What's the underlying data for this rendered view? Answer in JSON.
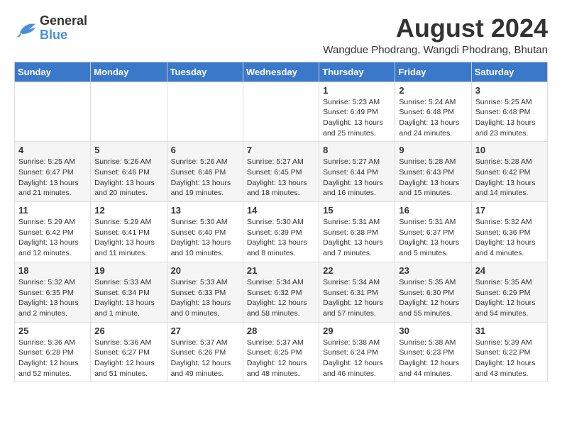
{
  "logo": {
    "text_general": "General",
    "text_blue": "Blue"
  },
  "header": {
    "month_year": "August 2024",
    "location": "Wangdue Phodrang, Wangdi Phodrang, Bhutan"
  },
  "weekdays": [
    "Sunday",
    "Monday",
    "Tuesday",
    "Wednesday",
    "Thursday",
    "Friday",
    "Saturday"
  ],
  "weeks": [
    [
      {
        "day": "",
        "sunrise": "",
        "sunset": "",
        "daylight": ""
      },
      {
        "day": "",
        "sunrise": "",
        "sunset": "",
        "daylight": ""
      },
      {
        "day": "",
        "sunrise": "",
        "sunset": "",
        "daylight": ""
      },
      {
        "day": "",
        "sunrise": "",
        "sunset": "",
        "daylight": ""
      },
      {
        "day": "1",
        "sunrise": "Sunrise: 5:23 AM",
        "sunset": "Sunset: 6:49 PM",
        "daylight": "Daylight: 13 hours and 25 minutes."
      },
      {
        "day": "2",
        "sunrise": "Sunrise: 5:24 AM",
        "sunset": "Sunset: 6:48 PM",
        "daylight": "Daylight: 13 hours and 24 minutes."
      },
      {
        "day": "3",
        "sunrise": "Sunrise: 5:25 AM",
        "sunset": "Sunset: 6:48 PM",
        "daylight": "Daylight: 13 hours and 23 minutes."
      }
    ],
    [
      {
        "day": "4",
        "sunrise": "Sunrise: 5:25 AM",
        "sunset": "Sunset: 6:47 PM",
        "daylight": "Daylight: 13 hours and 21 minutes."
      },
      {
        "day": "5",
        "sunrise": "Sunrise: 5:26 AM",
        "sunset": "Sunset: 6:46 PM",
        "daylight": "Daylight: 13 hours and 20 minutes."
      },
      {
        "day": "6",
        "sunrise": "Sunrise: 5:26 AM",
        "sunset": "Sunset: 6:46 PM",
        "daylight": "Daylight: 13 hours and 19 minutes."
      },
      {
        "day": "7",
        "sunrise": "Sunrise: 5:27 AM",
        "sunset": "Sunset: 6:45 PM",
        "daylight": "Daylight: 13 hours and 18 minutes."
      },
      {
        "day": "8",
        "sunrise": "Sunrise: 5:27 AM",
        "sunset": "Sunset: 6:44 PM",
        "daylight": "Daylight: 13 hours and 16 minutes."
      },
      {
        "day": "9",
        "sunrise": "Sunrise: 5:28 AM",
        "sunset": "Sunset: 6:43 PM",
        "daylight": "Daylight: 13 hours and 15 minutes."
      },
      {
        "day": "10",
        "sunrise": "Sunrise: 5:28 AM",
        "sunset": "Sunset: 6:42 PM",
        "daylight": "Daylight: 13 hours and 14 minutes."
      }
    ],
    [
      {
        "day": "11",
        "sunrise": "Sunrise: 5:29 AM",
        "sunset": "Sunset: 6:42 PM",
        "daylight": "Daylight: 13 hours and 12 minutes."
      },
      {
        "day": "12",
        "sunrise": "Sunrise: 5:29 AM",
        "sunset": "Sunset: 6:41 PM",
        "daylight": "Daylight: 13 hours and 11 minutes."
      },
      {
        "day": "13",
        "sunrise": "Sunrise: 5:30 AM",
        "sunset": "Sunset: 6:40 PM",
        "daylight": "Daylight: 13 hours and 10 minutes."
      },
      {
        "day": "14",
        "sunrise": "Sunrise: 5:30 AM",
        "sunset": "Sunset: 6:39 PM",
        "daylight": "Daylight: 13 hours and 8 minutes."
      },
      {
        "day": "15",
        "sunrise": "Sunrise: 5:31 AM",
        "sunset": "Sunset: 6:38 PM",
        "daylight": "Daylight: 13 hours and 7 minutes."
      },
      {
        "day": "16",
        "sunrise": "Sunrise: 5:31 AM",
        "sunset": "Sunset: 6:37 PM",
        "daylight": "Daylight: 13 hours and 5 minutes."
      },
      {
        "day": "17",
        "sunrise": "Sunrise: 5:32 AM",
        "sunset": "Sunset: 6:36 PM",
        "daylight": "Daylight: 13 hours and 4 minutes."
      }
    ],
    [
      {
        "day": "18",
        "sunrise": "Sunrise: 5:32 AM",
        "sunset": "Sunset: 6:35 PM",
        "daylight": "Daylight: 13 hours and 2 minutes."
      },
      {
        "day": "19",
        "sunrise": "Sunrise: 5:33 AM",
        "sunset": "Sunset: 6:34 PM",
        "daylight": "Daylight: 13 hours and 1 minute."
      },
      {
        "day": "20",
        "sunrise": "Sunrise: 5:33 AM",
        "sunset": "Sunset: 6:33 PM",
        "daylight": "Daylight: 13 hours and 0 minutes."
      },
      {
        "day": "21",
        "sunrise": "Sunrise: 5:34 AM",
        "sunset": "Sunset: 6:32 PM",
        "daylight": "Daylight: 12 hours and 58 minutes."
      },
      {
        "day": "22",
        "sunrise": "Sunrise: 5:34 AM",
        "sunset": "Sunset: 6:31 PM",
        "daylight": "Daylight: 12 hours and 57 minutes."
      },
      {
        "day": "23",
        "sunrise": "Sunrise: 5:35 AM",
        "sunset": "Sunset: 6:30 PM",
        "daylight": "Daylight: 12 hours and 55 minutes."
      },
      {
        "day": "24",
        "sunrise": "Sunrise: 5:35 AM",
        "sunset": "Sunset: 6:29 PM",
        "daylight": "Daylight: 12 hours and 54 minutes."
      }
    ],
    [
      {
        "day": "25",
        "sunrise": "Sunrise: 5:36 AM",
        "sunset": "Sunset: 6:28 PM",
        "daylight": "Daylight: 12 hours and 52 minutes."
      },
      {
        "day": "26",
        "sunrise": "Sunrise: 5:36 AM",
        "sunset": "Sunset: 6:27 PM",
        "daylight": "Daylight: 12 hours and 51 minutes."
      },
      {
        "day": "27",
        "sunrise": "Sunrise: 5:37 AM",
        "sunset": "Sunset: 6:26 PM",
        "daylight": "Daylight: 12 hours and 49 minutes."
      },
      {
        "day": "28",
        "sunrise": "Sunrise: 5:37 AM",
        "sunset": "Sunset: 6:25 PM",
        "daylight": "Daylight: 12 hours and 48 minutes."
      },
      {
        "day": "29",
        "sunrise": "Sunrise: 5:38 AM",
        "sunset": "Sunset: 6:24 PM",
        "daylight": "Daylight: 12 hours and 46 minutes."
      },
      {
        "day": "30",
        "sunrise": "Sunrise: 5:38 AM",
        "sunset": "Sunset: 6:23 PM",
        "daylight": "Daylight: 12 hours and 44 minutes."
      },
      {
        "day": "31",
        "sunrise": "Sunrise: 5:39 AM",
        "sunset": "Sunset: 6:22 PM",
        "daylight": "Daylight: 12 hours and 43 minutes."
      }
    ]
  ]
}
